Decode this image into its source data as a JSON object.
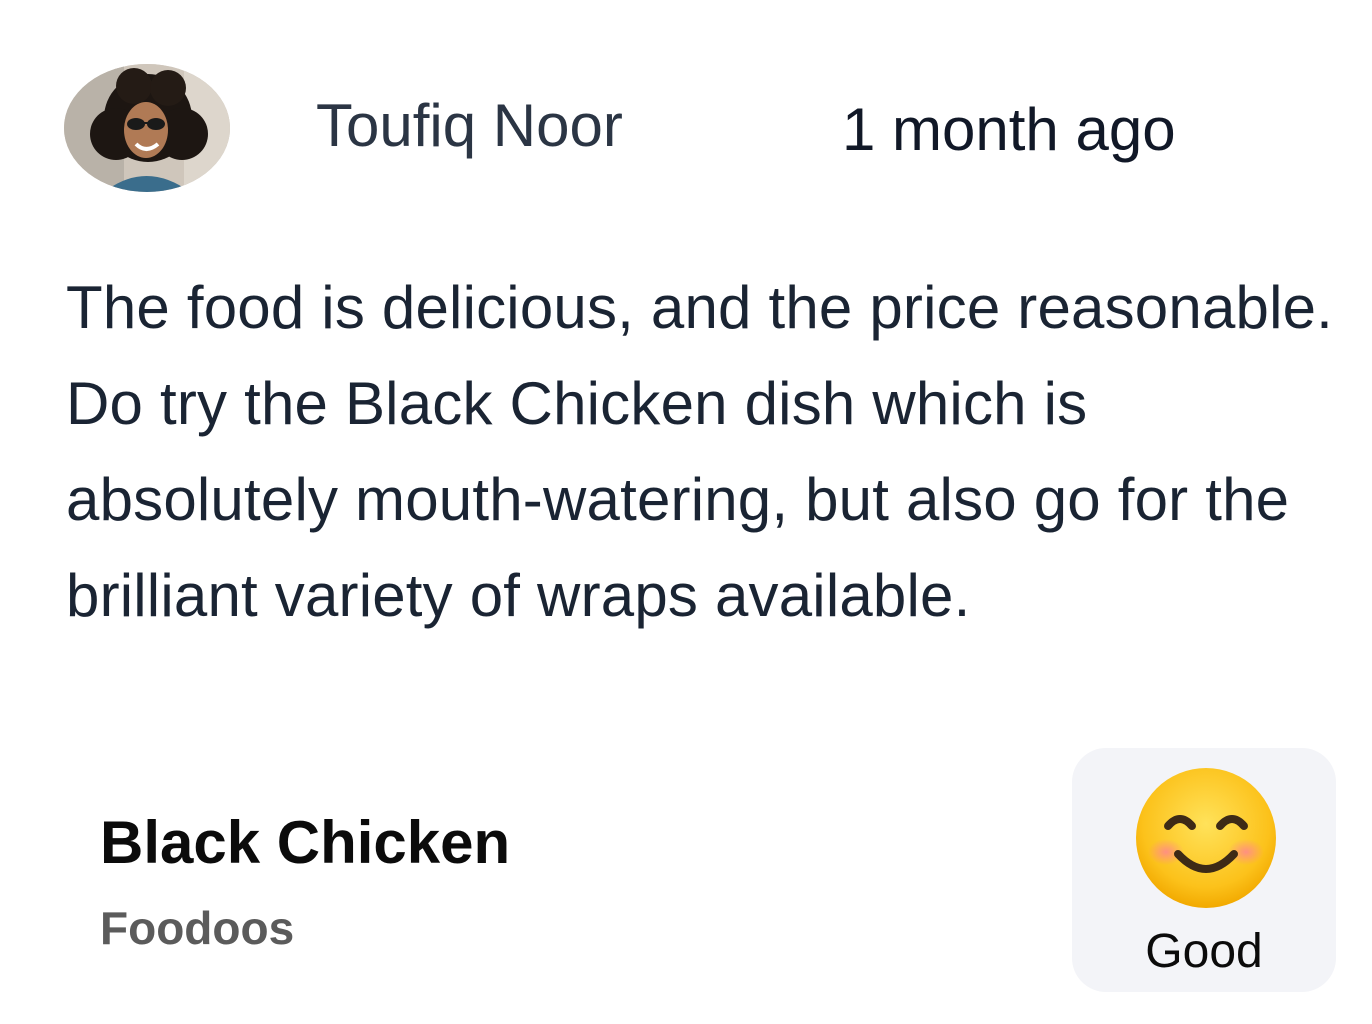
{
  "review": {
    "reviewer_name": "Toufiq Noor",
    "timestamp": "1 month ago",
    "text": "The food is delicious, and the price reasonable. Do try the Black Chicken dish which is absolutely mouth-watering, but also go for the brilliant variety of wraps available."
  },
  "dish": {
    "name": "Black Chicken",
    "restaurant": "Foodoos"
  },
  "rating": {
    "label": "Good",
    "icon": "smiling-face-icon"
  }
}
